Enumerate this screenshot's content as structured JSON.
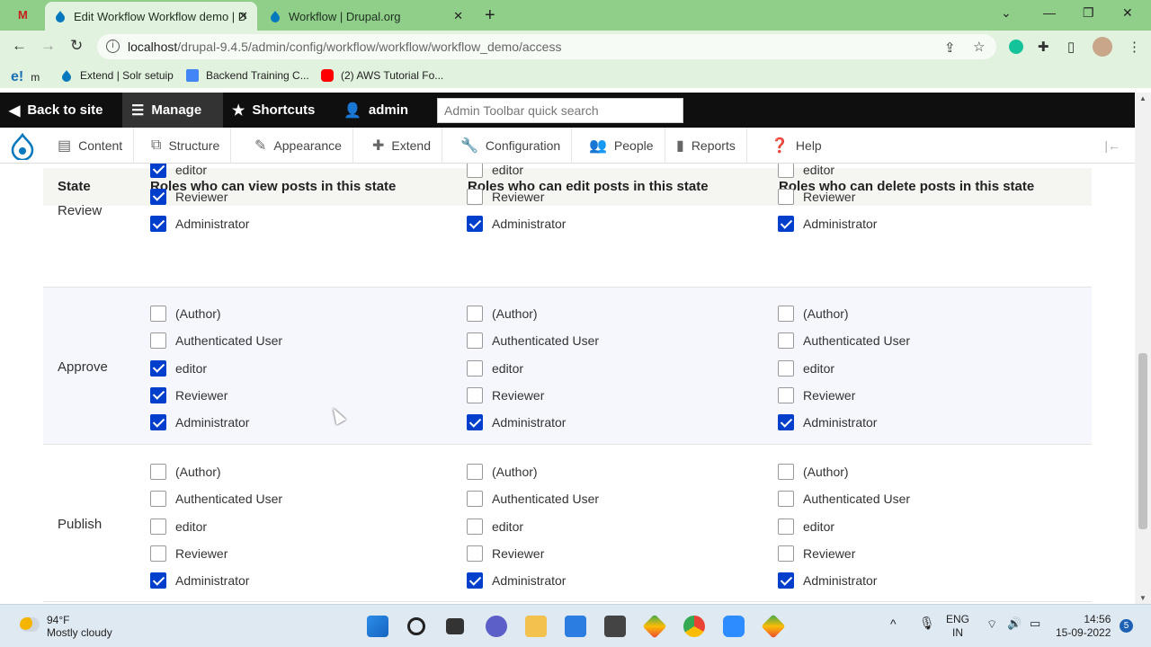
{
  "browser": {
    "tabs": [
      {
        "label": "Edit Workflow Workflow demo | D"
      },
      {
        "label": "Workflow | Drupal.org"
      }
    ],
    "url_host": "localhost",
    "url_path": "/drupal-9.4.5/admin/config/workflow/workflow/workflow_demo/access",
    "bookmarks": [
      {
        "label": "m"
      },
      {
        "label": "Extend | Solr setuip"
      },
      {
        "label": "Backend Training C..."
      },
      {
        "label": "(2) AWS Tutorial Fo..."
      }
    ],
    "bookmark_prefix": "e!"
  },
  "toolbar": {
    "back_to_site": "Back to site",
    "manage": "Manage",
    "shortcuts": "Shortcuts",
    "user": "admin",
    "search_placeholder": "Admin Toolbar quick search"
  },
  "tray": {
    "items": [
      "Content",
      "Structure",
      "Appearance",
      "Extend",
      "Configuration",
      "People",
      "Reports",
      "Help"
    ]
  },
  "table": {
    "headers": [
      "State",
      "Roles who can view posts in this state",
      "Roles who can edit posts in this state",
      "Roles who can delete posts in this state"
    ],
    "roles": [
      "(Author)",
      "Authenticated User",
      "editor",
      "Reviewer",
      "Administrator"
    ],
    "rows": [
      {
        "state": "Review",
        "view": [
          null,
          null,
          true,
          true,
          true
        ],
        "edit": [
          null,
          null,
          false,
          false,
          true
        ],
        "delete": [
          null,
          null,
          false,
          false,
          true
        ]
      },
      {
        "state": "Approve",
        "view": [
          false,
          false,
          true,
          true,
          true
        ],
        "edit": [
          false,
          false,
          false,
          false,
          true
        ],
        "delete": [
          false,
          false,
          false,
          false,
          true
        ]
      },
      {
        "state": "Publish",
        "view": [
          false,
          false,
          false,
          false,
          true
        ],
        "edit": [
          false,
          false,
          false,
          false,
          true
        ],
        "delete": [
          false,
          false,
          false,
          false,
          true
        ]
      }
    ]
  },
  "taskbar": {
    "weather_temp": "94°F",
    "weather_desc": "Mostly cloudy",
    "lang_top": "ENG",
    "lang_bottom": "IN",
    "time": "14:56",
    "date": "15-09-2022",
    "notifications": "5"
  },
  "colors": {
    "tab_strip": "#8fcf8a",
    "checkbox_checked": "#003ecc",
    "admin_bar": "#0f0f0f"
  }
}
